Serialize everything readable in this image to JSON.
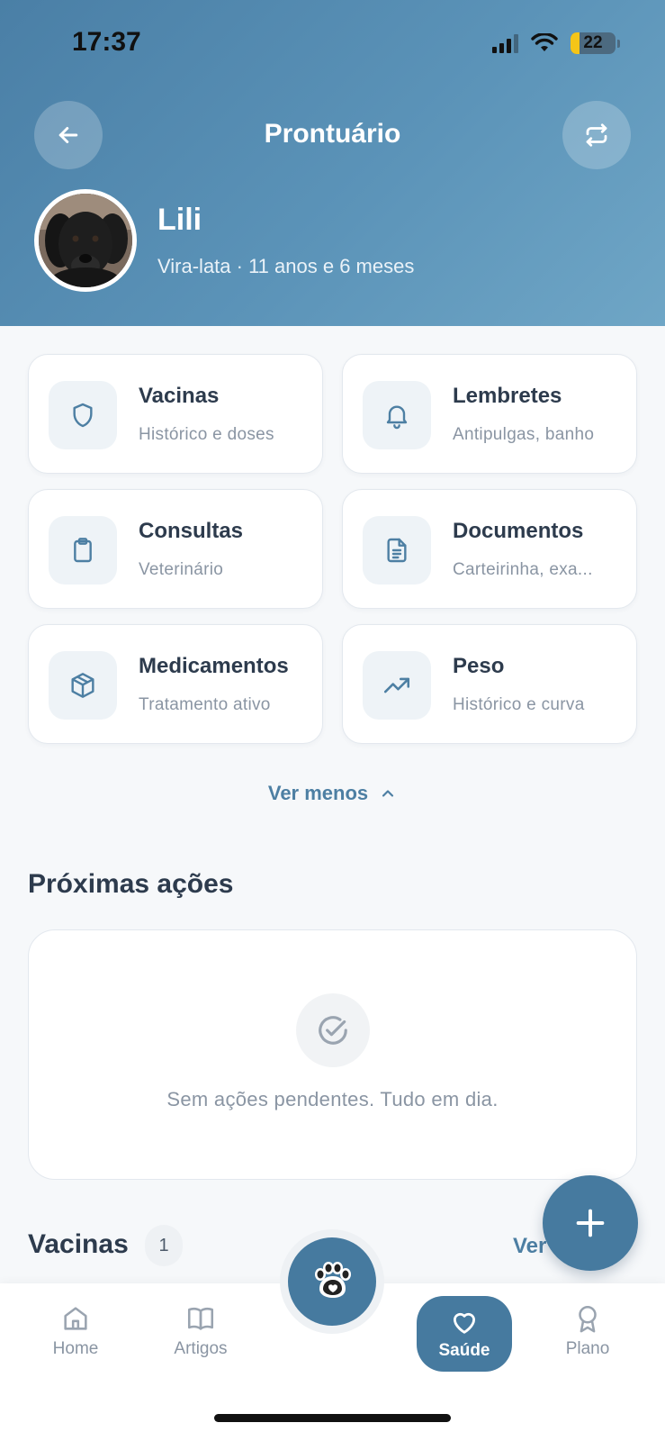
{
  "status_bar": {
    "time": "17:37",
    "battery": "22"
  },
  "header": {
    "title": "Prontuário"
  },
  "pet": {
    "name": "Lili",
    "info": "Vira-lata · 11 anos e 6 meses"
  },
  "cards": [
    {
      "title": "Vacinas",
      "subtitle": "Histórico e doses",
      "icon": "shield-icon"
    },
    {
      "title": "Lembretes",
      "subtitle": "Antipulgas, banho",
      "icon": "bell-icon"
    },
    {
      "title": "Consultas",
      "subtitle": "Veterinário",
      "icon": "clipboard-icon"
    },
    {
      "title": "Documentos",
      "subtitle": "Carteirinha, exa...",
      "icon": "document-icon"
    },
    {
      "title": "Medicamentos",
      "subtitle": "Tratamento ativo",
      "icon": "box-icon"
    },
    {
      "title": "Peso",
      "subtitle": "Histórico e curva",
      "icon": "trending-up-icon"
    }
  ],
  "see_less": "Ver menos",
  "next_actions": {
    "title": "Próximas ações",
    "empty_text": "Sem ações pendentes. Tudo em dia."
  },
  "vaccines_section": {
    "title": "Vacinas",
    "count": "1",
    "see_all": "Ver"
  },
  "tabs": {
    "home": "Home",
    "articles": "Artigos",
    "health": "Saúde",
    "plan": "Plano"
  },
  "colors": {
    "primary": "#467a9f",
    "header_start": "#4a7fa6",
    "header_end": "#6fa6c6",
    "text": "#2d3b4d",
    "muted": "#8a95a3"
  }
}
